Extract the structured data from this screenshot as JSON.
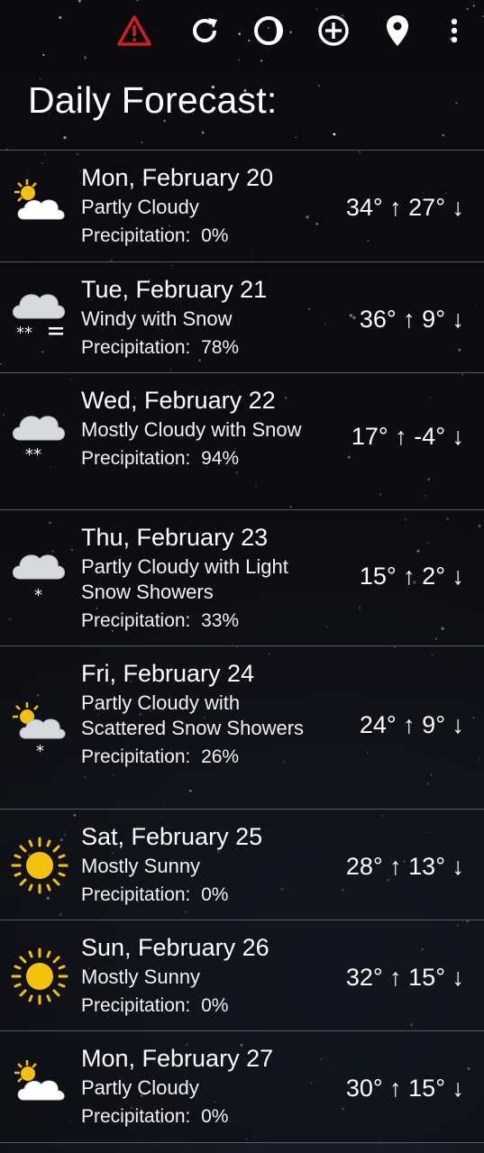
{
  "page": {
    "title": "Daily Forecast:"
  },
  "toolbar": {
    "icons": [
      "alert-icon",
      "refresh-icon",
      "theme-icon",
      "add-location-icon",
      "location-pin-icon",
      "more-options-icon"
    ],
    "alert_color": "#d21f1f"
  },
  "forecast": [
    {
      "date": "Mon, February 20",
      "condition": "Partly Cloudy",
      "precipitation": "Precipitation:  0%",
      "temps": "34° ↑ 27° ↓",
      "icon": "partly-cloudy-icon"
    },
    {
      "date": "Tue, February 21",
      "condition": "Windy with Snow",
      "precipitation": "Precipitation:  78%",
      "temps": "36° ↑ 9° ↓",
      "icon": "windy-snow-icon"
    },
    {
      "date": "Wed, February 22",
      "condition": "Mostly Cloudy with Snow",
      "precipitation": "Precipitation:  94%",
      "temps": "17° ↑ -4° ↓",
      "icon": "cloud-snow-icon"
    },
    {
      "date": "Thu, February 23",
      "condition": "Partly Cloudy with Light Snow Showers",
      "precipitation": "Precipitation:  33%",
      "temps": "15° ↑ 2° ↓",
      "icon": "cloud-light-snow-icon"
    },
    {
      "date": "Fri, February 24",
      "condition": "Partly Cloudy with Scattered Snow Showers",
      "precipitation": "Precipitation:  26%",
      "temps": "24° ↑ 9° ↓",
      "icon": "sun-cloud-snow-icon"
    },
    {
      "date": "Sat, February 25",
      "condition": "Mostly Sunny",
      "precipitation": "Precipitation:  0%",
      "temps": "28° ↑ 13° ↓",
      "icon": "sun-icon"
    },
    {
      "date": "Sun, February 26",
      "condition": "Mostly Sunny",
      "precipitation": "Precipitation:  0%",
      "temps": "32° ↑ 15° ↓",
      "icon": "sun-icon"
    },
    {
      "date": "Mon, February 27",
      "condition": "Partly Cloudy",
      "precipitation": "Precipitation:  0%",
      "temps": "30° ↑ 15° ↓",
      "icon": "partly-cloudy-icon"
    }
  ]
}
